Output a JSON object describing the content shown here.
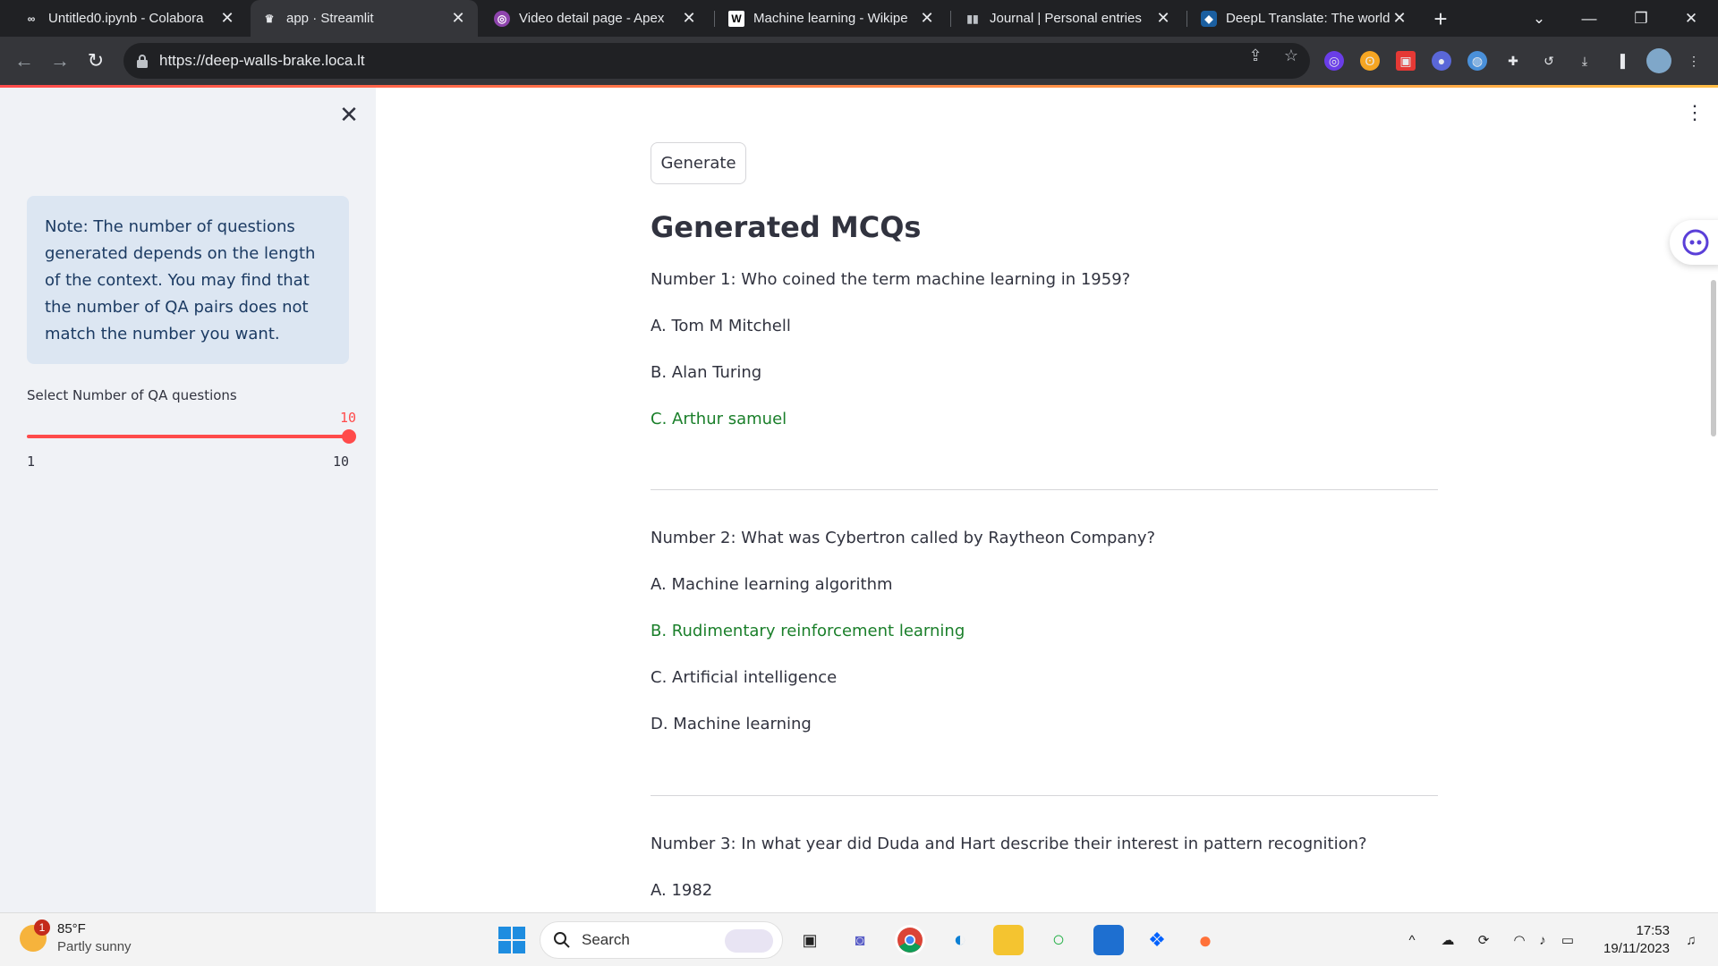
{
  "browser": {
    "tabs": [
      {
        "title": "Untitled0.ipynb - Colabora",
        "icon": "colab-icon"
      },
      {
        "title": "app · Streamlit",
        "icon": "streamlit-icon",
        "active": true
      },
      {
        "title": "Video detail page - Apex",
        "icon": "apex-icon"
      },
      {
        "title": "Machine learning - Wikipe",
        "icon": "wikipedia-icon"
      },
      {
        "title": "Journal | Personal entries",
        "icon": "journal-icon"
      },
      {
        "title": "DeepL Translate: The world",
        "icon": "deepl-icon"
      }
    ],
    "url": "https://deep-walls-brake.loca.lt"
  },
  "sidebar": {
    "note": "Note: The number of questions generated depends on the length of the context. You may find that the number of QA pairs does not match the number you want.",
    "slider": {
      "label": "Select Number of QA questions",
      "value": "10",
      "min": "1",
      "max": "10",
      "fill_fraction": 1.0
    }
  },
  "main": {
    "generate_label": "Generate",
    "heading": "Generated MCQs",
    "questions": [
      {
        "question": "Number 1: Who coined the term machine learning in 1959?",
        "options": [
          "A. Tom M Mitchell",
          "B. Alan Turing",
          "C. Arthur samuel"
        ],
        "correct_index": 2
      },
      {
        "question": "Number 2: What was Cybertron called by Raytheon Company?",
        "options": [
          "A. Machine learning algorithm",
          "B. Rudimentary reinforcement learning",
          "C. Artificial intelligence",
          "D. Machine learning"
        ],
        "correct_index": 1
      },
      {
        "question": "Number 3: In what year did Duda and Hart describe their interest in pattern recognition?",
        "options": [
          "A. 1982"
        ],
        "correct_index": -1
      }
    ]
  },
  "taskbar": {
    "weather_temp": "85°F",
    "weather_desc": "Partly sunny",
    "weather_badge": "1",
    "search_label": "Search",
    "time": "17:53",
    "date": "19/11/2023"
  },
  "colors": {
    "accent": "#ff4b4b",
    "correct": "#1a7f2a",
    "note_bg": "#dce6f2"
  }
}
